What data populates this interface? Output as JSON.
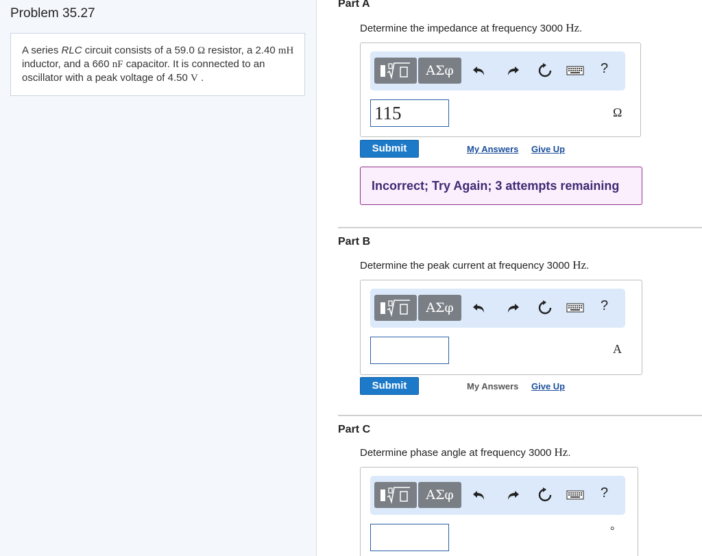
{
  "problem": {
    "title": "Problem 35.27",
    "text_parts": {
      "p1": "A series ",
      "rlc": "RLC",
      "p2": " circuit consists of a 59.0 ",
      "ohm": "Ω",
      "p3": " resistor, a 2.40 ",
      "mh": "mH",
      "p4": " inductor, and a 660 ",
      "nf": "nF",
      "p5": " capacitor. It is connected to an oscillator with a peak voltage of 4.50 ",
      "v": "V",
      "p6": " ."
    }
  },
  "toolbar": {
    "greek_label": "ΑΣφ",
    "help_label": "?"
  },
  "parts": [
    {
      "title": "Part A",
      "question_pre": "Determine the impedance at frequency 3000 ",
      "question_unit": "Hz",
      "question_post": ".",
      "input_value": "115",
      "unit": "Ω",
      "submit_label": "Submit",
      "my_answers_label": "My Answers",
      "give_up_label": "Give Up",
      "feedback": "Incorrect; Try Again; 3 attempts remaining"
    },
    {
      "title": "Part B",
      "question_pre": "Determine the peak current at frequency 3000 ",
      "question_unit": "Hz",
      "question_post": ".",
      "input_value": "",
      "unit": "A",
      "submit_label": "Submit",
      "my_answers_label": "My Answers",
      "give_up_label": "Give Up"
    },
    {
      "title": "Part C",
      "question_pre": "Determine phase angle at frequency 3000 ",
      "question_unit": "Hz",
      "question_post": ".",
      "input_value": "",
      "unit": "°"
    }
  ]
}
